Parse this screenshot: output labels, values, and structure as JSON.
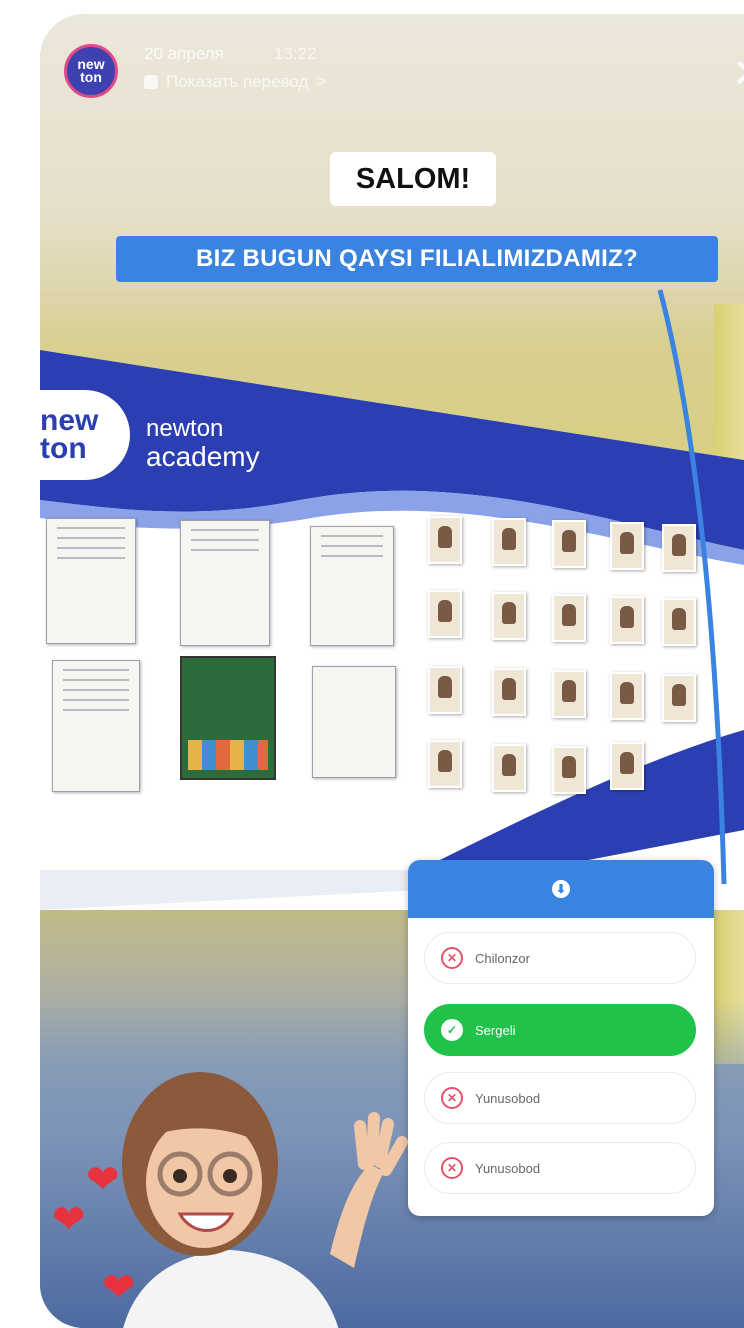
{
  "story": {
    "account": {
      "avatar_line1": "new",
      "avatar_line2": "ton"
    },
    "date": "20 апреля",
    "time": "13:22",
    "translate_label": "Показать перевод",
    "translate_chevron": ">",
    "close_symbol": "✕"
  },
  "captions": {
    "greeting": "SALOM!",
    "question": "BIZ BUGUN QAYSI FILIALIMIZDAMIZ?"
  },
  "banner": {
    "logo_line1": "new",
    "logo_line2": "ton",
    "brand_line1": "newton",
    "brand_line2": "academy"
  },
  "quiz": {
    "header_icon": "download-arrow-icon",
    "options": [
      {
        "label": "Chilonzor",
        "state": "wrong"
      },
      {
        "label": "Sergeli",
        "state": "correct"
      },
      {
        "label": "Yunusobod",
        "state": "wrong"
      },
      {
        "label": "Yunusobod",
        "state": "wrong"
      }
    ],
    "colors": {
      "header": "#3a83e0",
      "correct": "#20c24a",
      "wrong": "#e5526a"
    }
  },
  "icons": {
    "close": "close-icon",
    "wrong": "x-circle-icon",
    "correct": "check-circle-icon",
    "heart": "heart-icon"
  }
}
